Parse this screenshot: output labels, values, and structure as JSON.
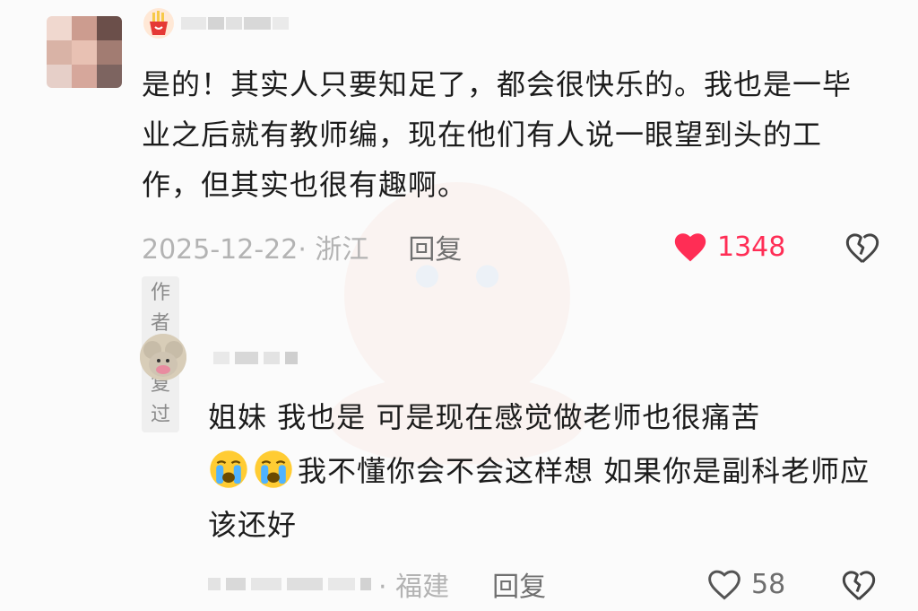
{
  "comment": {
    "text": "是的！其实人只要知足了，都会很快乐的。我也是一毕业之后就有教师编，现在他们有人说一眼望到头的工作，但其实也很有趣啊。",
    "date_location": "2025-12-22· 浙江",
    "reply_label": "回复",
    "like_count": "1348",
    "author_tag": "作者回复过",
    "like_color": "#ff2d55"
  },
  "reply": {
    "line1": "姐妹 我也是 可是现在感觉做老师也很痛苦",
    "line2": "我不懂你会不会这样想 如果你是副科老师应该还好",
    "location": "· 福建",
    "reply_label": "回复",
    "like_count": "58"
  },
  "icons": {
    "badge": "fries-badge-icon",
    "heart_filled": "heart-filled-icon",
    "heart_outline": "heart-outline-icon",
    "broken_heart": "broken-heart-icon",
    "crying_emoji": "crying-face-emoji"
  }
}
